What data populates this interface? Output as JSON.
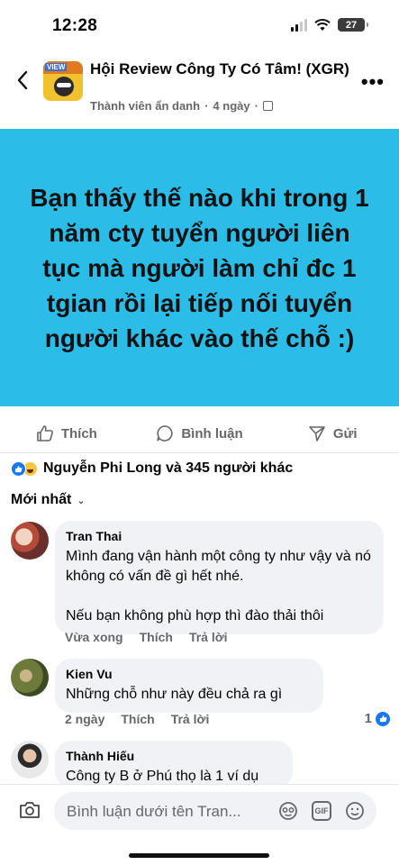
{
  "status_bar": {
    "time": "12:28",
    "battery": "27"
  },
  "header": {
    "group_name": "Hội Review Công Ty Có Tâm! (XGR)",
    "logo_tag": "VIEW",
    "author": "Thành viên ẩn danh",
    "separator": "·",
    "age": "4 ngày"
  },
  "post": {
    "text": "Bạn thấy thế nào khi trong 1 năm cty tuyển người liên tục mà người làm chỉ đc 1 tgian rồi lại tiếp nối tuyển người khác vào thế chỗ :)",
    "background": "#2bbde8"
  },
  "actions": {
    "like": "Thích",
    "comment": "Bình luận",
    "send": "Gửi"
  },
  "reactions": {
    "summary": "Nguyễn Phi Long và 345 người khác"
  },
  "sort": {
    "label": "Mới nhất"
  },
  "comments": [
    {
      "name": "Tran Thai",
      "text": "Mình đang vận hành một công ty như vậy và nó không có vấn đề gì hết nhé.\n\nNếu bạn không phù hợp thì đào thải thôi",
      "time": "Vừa xong",
      "like": "Thích",
      "reply": "Trả lời"
    },
    {
      "name": "Kien Vu",
      "text": "Những chỗ như này đều chả ra gì",
      "time": "2 ngày",
      "like": "Thích",
      "reply": "Trả lời",
      "likes": "1"
    },
    {
      "name": "Thành Hiếu",
      "text": "Công ty B ở Phú thọ là 1 ví dụ"
    }
  ],
  "composer": {
    "placeholder": "Bình luận dưới tên Tran..."
  },
  "accent": "#1877f2"
}
